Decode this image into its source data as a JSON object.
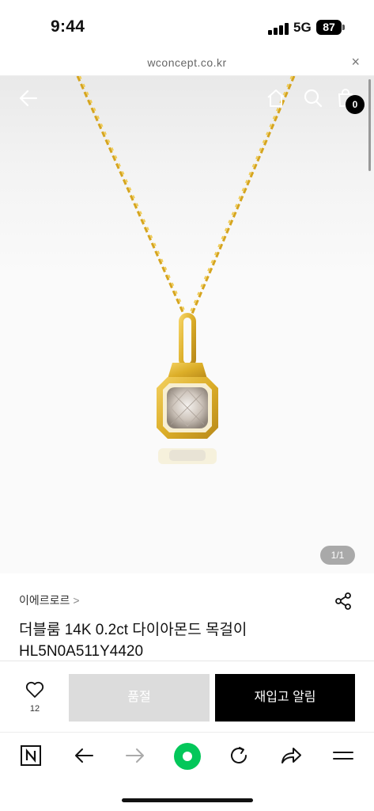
{
  "status": {
    "time": "9:44",
    "network": "5G",
    "battery": "87"
  },
  "browser": {
    "url": "wconcept.co.kr",
    "close_label": "×"
  },
  "header": {
    "cart_count": "0"
  },
  "gallery": {
    "page_indicator": "1/1"
  },
  "product": {
    "brand": "이에르로르",
    "brand_chevron": ">",
    "name_line1": "더블룸 14K 0.2ct 다이아몬드 목걸이",
    "name_line2": "HL5N0A511Y4420"
  },
  "actions": {
    "like_count": "12",
    "soldout_label": "품절",
    "restock_label": "재입고 알림"
  },
  "colors": {
    "accent_green": "#03c75a",
    "soldout_bg": "#dcdcdc",
    "primary_button": "#000000"
  }
}
